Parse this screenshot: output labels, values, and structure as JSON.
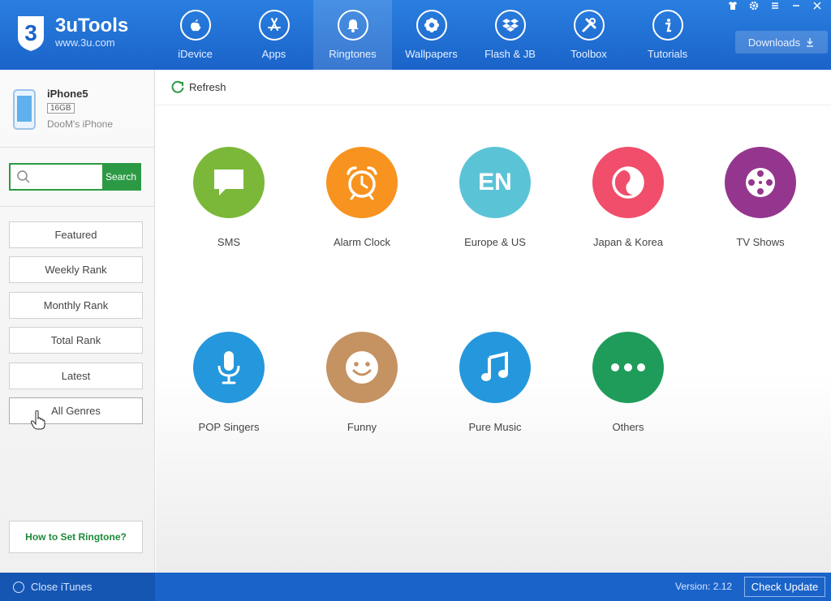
{
  "app": {
    "name": "3uTools",
    "url": "www.3u.com",
    "logo_digit": "3"
  },
  "nav": [
    {
      "label": "iDevice",
      "icon": "apple-icon"
    },
    {
      "label": "Apps",
      "icon": "appstore-icon"
    },
    {
      "label": "Ringtones",
      "icon": "bell-icon",
      "active": true
    },
    {
      "label": "Wallpapers",
      "icon": "flower-icon"
    },
    {
      "label": "Flash & JB",
      "icon": "dropbox-icon"
    },
    {
      "label": "Toolbox",
      "icon": "tools-icon"
    },
    {
      "label": "Tutorials",
      "icon": "info-icon"
    }
  ],
  "window_controls": [
    "shirt-icon",
    "gear-icon",
    "menu-icon",
    "minimize-icon",
    "close-icon"
  ],
  "downloads_label": "Downloads",
  "device": {
    "name": "iPhone5",
    "capacity": "16GB",
    "owner": "DooM's iPhone"
  },
  "search": {
    "placeholder": "",
    "button_label": "Search"
  },
  "menu": {
    "featured": "Featured",
    "weekly": "Weekly Rank",
    "monthly": "Monthly Rank",
    "total": "Total Rank",
    "latest": "Latest",
    "all_genres": "All Genres"
  },
  "howto_label": "How to Set Ringtone?",
  "refresh_label": "Refresh",
  "categories": [
    {
      "label": "SMS",
      "color": "#7bb83a",
      "icon": "chat-bubble-icon"
    },
    {
      "label": "Alarm Clock",
      "color": "#f7931e",
      "icon": "alarm-clock-icon"
    },
    {
      "label": "Europe & US",
      "color": "#5bc3d6",
      "icon": "en-text-icon",
      "icon_text": "EN"
    },
    {
      "label": "Japan & Korea",
      "color": "#f04e6b",
      "icon": "yin-yang-icon"
    },
    {
      "label": "TV Shows",
      "color": "#94368e",
      "icon": "film-reel-icon"
    },
    {
      "label": "POP Singers",
      "color": "#2597dc",
      "icon": "microphone-icon"
    },
    {
      "label": "Funny",
      "color": "#c59262",
      "icon": "smiley-icon"
    },
    {
      "label": "Pure Music",
      "color": "#2597dc",
      "icon": "music-note-icon"
    },
    {
      "label": "Others",
      "color": "#1f9c5a",
      "icon": "ellipsis-icon"
    }
  ],
  "footer": {
    "close_itunes": "Close iTunes",
    "version": "Version: 2.12",
    "check_update": "Check Update"
  }
}
